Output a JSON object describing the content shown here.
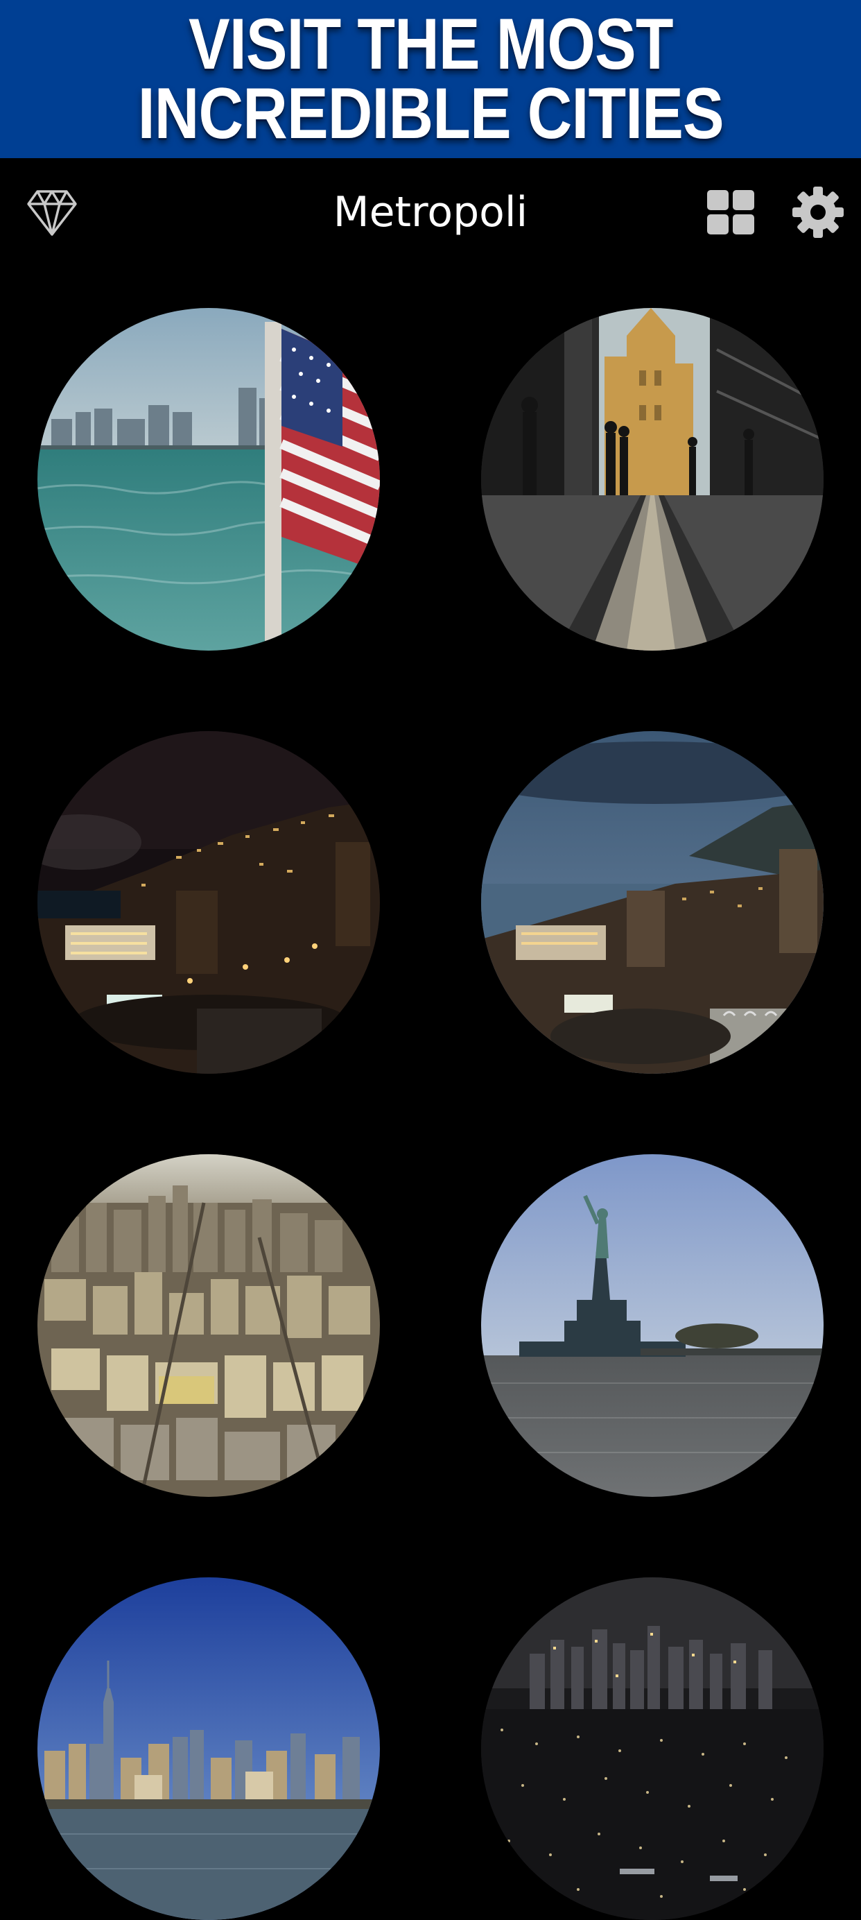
{
  "banner": {
    "line1": "VISIT THE MOST",
    "line2": "INCREDIBLE CITIES"
  },
  "navbar": {
    "title": "Metropoli",
    "left_icon": "diamond-icon",
    "right_icons": [
      "grid-view-icon",
      "settings-gear-icon"
    ]
  },
  "colors": {
    "banner_background": "#003f93",
    "app_background": "#000000",
    "text": "#ffffff",
    "icon": "#c8c8c8"
  },
  "city_tiles": [
    {
      "name": "city-tile-harbor-flag",
      "scene": "harbor with american flag"
    },
    {
      "name": "city-tile-tower-bridge",
      "scene": "tower bridge view"
    },
    {
      "name": "city-tile-monaco-night",
      "scene": "coastal city at night"
    },
    {
      "name": "city-tile-monaco-dusk",
      "scene": "coastal city at dusk"
    },
    {
      "name": "city-tile-manhattan-aerial",
      "scene": "aerial city view"
    },
    {
      "name": "city-tile-statue-liberty",
      "scene": "statue of liberty"
    },
    {
      "name": "city-tile-manhattan-skyline",
      "scene": "skyline from water"
    },
    {
      "name": "city-tile-night-skyline",
      "scene": "city lights at night"
    }
  ]
}
